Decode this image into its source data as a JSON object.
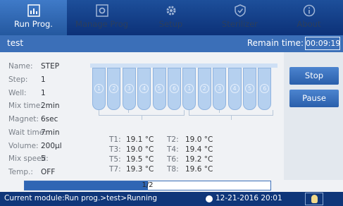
{
  "tabs": [
    {
      "label": "Run Prog.",
      "icon": "bar-chart-icon",
      "active": true
    },
    {
      "label": "Manage Prog",
      "icon": "gear-box-icon",
      "active": false
    },
    {
      "label": "Setup",
      "icon": "gear-icon",
      "active": false
    },
    {
      "label": "Sterilizer",
      "icon": "shield-icon",
      "active": false
    },
    {
      "label": "About",
      "icon": "info-icon",
      "active": false
    }
  ],
  "header": {
    "title": "test",
    "remain_label": "Remain time:",
    "remain_value": "00:09:19"
  },
  "info": [
    {
      "key": "Name:",
      "value": "STEP"
    },
    {
      "key": "Step:",
      "value": "1"
    },
    {
      "key": "Well:",
      "value": "1"
    },
    {
      "key": "Mix time:",
      "value": "2min"
    },
    {
      "key": "Magnet:",
      "value": "6sec"
    },
    {
      "key": "Wait time:",
      "value": "7min"
    },
    {
      "key": "Volume:",
      "value": "200µl"
    },
    {
      "key": "Mix speed:",
      "value": "5"
    },
    {
      "key": "Temp.:",
      "value": "OFF"
    }
  ],
  "wells": [
    "1",
    "2",
    "3",
    "4",
    "5",
    "6",
    "1",
    "2",
    "3",
    "4",
    "5",
    "6"
  ],
  "temps": [
    {
      "label": "T1:",
      "value": "19.1 °C"
    },
    {
      "label": "T2:",
      "value": "19.0 °C"
    },
    {
      "label": "T3:",
      "value": "19.0 °C"
    },
    {
      "label": "T4:",
      "value": "19.4 °C"
    },
    {
      "label": "T5:",
      "value": "19.5 °C"
    },
    {
      "label": "T6:",
      "value": "19.2 °C"
    },
    {
      "label": "T7:",
      "value": "19.3 °C"
    },
    {
      "label": "T8:",
      "value": "19.6 °C"
    }
  ],
  "buttons": {
    "stop_label": "Stop",
    "pause_label": "Pause"
  },
  "progress": {
    "text": "1/2",
    "fraction": 0.5
  },
  "status": {
    "message": "Current module:Run prog.>test>Running",
    "datetime": "12-21-2016 20:01",
    "clock_icon": "clock-icon",
    "bulb_icon": "light-bulb-icon"
  },
  "colors": {
    "tabbar": "#0c3178",
    "active_tab": "#3f7ac8",
    "header": "#3b6fb8",
    "button": "#2a5fab",
    "well_fill": "#b5d0ef",
    "progress_fill": "#2f66b4",
    "statusbar": "#0f3679"
  }
}
